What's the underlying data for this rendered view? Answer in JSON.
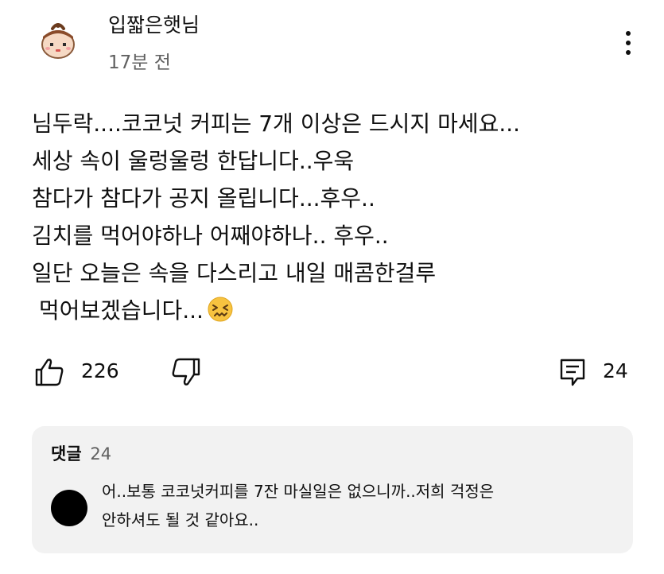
{
  "header": {
    "author": "입짧은햇님",
    "timestamp": "17분 전",
    "avatar_icon": "cartoon-character-avatar",
    "more_icon": "more-vertical-icon"
  },
  "content": {
    "lines": [
      "님두락....코코넛 커피는 7개 이상은 드시지 마세요...",
      "세상 속이 울렁울렁 한답니다..우욱",
      "참다가 참다가 공지 올립니다...후우..",
      "김치를 먹어야하나 어째야하나.. 후우..",
      "일단 오늘은 속을 다스리고 내일 매콤한걸루",
      " 먹어보겠습니다..."
    ],
    "emoji_icon": "confounded-face-emoji"
  },
  "actions": {
    "like_count": "226",
    "reply_count": "24",
    "like_icon": "thumbs-up-icon",
    "dislike_icon": "thumbs-down-icon",
    "reply_icon": "comment-icon"
  },
  "replies": {
    "label": "댓글",
    "count": "24",
    "top_reply": {
      "lines": [
        "어..보통 코코넛커피를 7잔 마실일은 없으니까..저희 걱정은",
        "안하셔도 될 것 같아요.."
      ]
    }
  }
}
